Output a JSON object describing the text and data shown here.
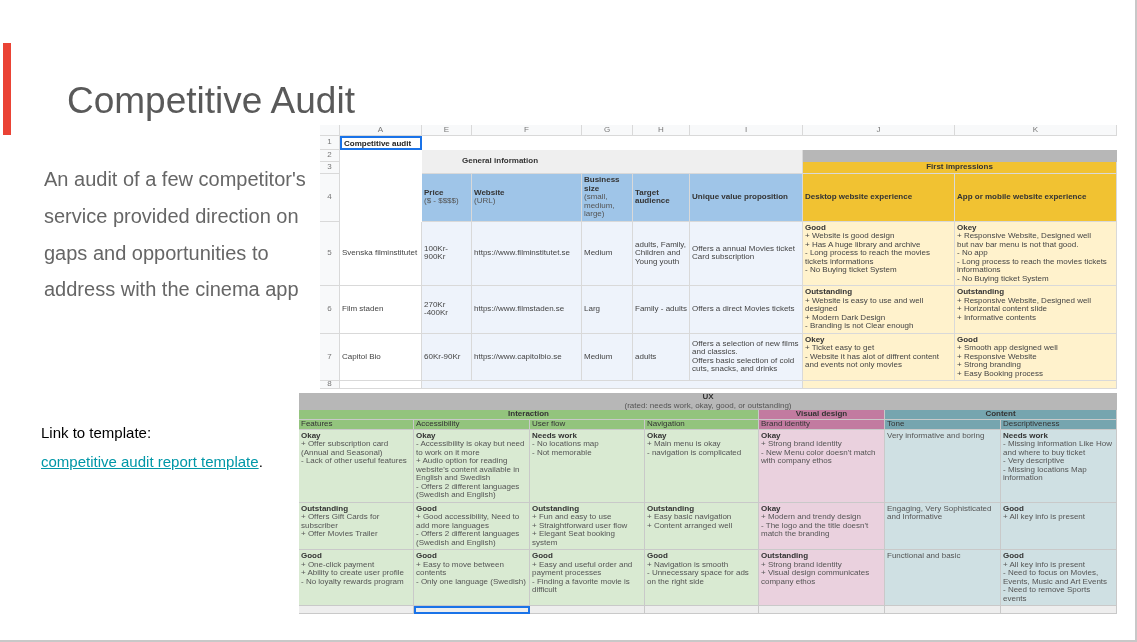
{
  "slide": {
    "title": "Competitive Audit",
    "body": "An audit of a few competitor's service provided direction on gaps and opportunities to address with the cinema app",
    "link_prefix": "Link to template:",
    "link_text": "competitive audit report template",
    "link_suffix": "."
  },
  "top_sheet": {
    "column_headers": [
      "A",
      "E",
      "F",
      "G",
      "H",
      "I",
      "J",
      "K"
    ],
    "row_numbers": [
      "1",
      "2",
      "3",
      "4",
      "5",
      "6",
      "7",
      "8"
    ],
    "title_cell": {
      "text": "Competitive audit",
      "selected": true
    },
    "general_header": "General information",
    "impressions_header": "First impressions",
    "columns": [
      {
        "label": "Price",
        "sublabel": "($ - $$$$)"
      },
      {
        "label": "Website",
        "sublabel": "(URL)"
      },
      {
        "label": "Business size",
        "sublabel": "(small, medium, large)"
      },
      {
        "label": "Target audience"
      },
      {
        "label": "Unique value proposition"
      },
      {
        "label": "Desktop website experience"
      },
      {
        "label": "App or mobile website experience"
      }
    ],
    "rows": [
      {
        "competitor": "Svenska filminstitutet",
        "price": "100Kr- 900Kr",
        "website": "https://www.filminstitutet.se",
        "business_size": "Medium",
        "target_audience": "adults, Family, Children and Young youth",
        "value_proposition": [
          "Offers a annual Movies ticket Card subscription"
        ],
        "desktop": {
          "rating": "Good",
          "lines": [
            "+ Website is good design",
            "+ Has A huge library and archive",
            "- Long process to reach the movies tickets informations",
            "- No Buying ticket System"
          ]
        },
        "mobile": {
          "rating": "Okey",
          "lines": [
            "+ Responsive Website, Designed well",
            "but nav bar menu is not that good.",
            "- No app",
            "- Long process to reach the movies tickets informations",
            "- No Buying ticket System"
          ]
        }
      },
      {
        "competitor": "Film staden",
        "price": "270Kr -400Kr",
        "website": "https://www.filmstaden.se",
        "business_size": "Larg",
        "target_audience": "Family - adults",
        "value_proposition": [
          "Offers a direct Movies tickets"
        ],
        "desktop": {
          "rating": "Outstanding",
          "lines": [
            "+ Website is easy to use and well designed",
            "+ Modern Dark Design",
            "- Branding is not Clear enough"
          ]
        },
        "mobile": {
          "rating": "Outstanding",
          "lines": [
            "+ Responsive Website, Designed well",
            "+ Horizontal content slide",
            "+ Informative contents"
          ]
        }
      },
      {
        "competitor": "Capitol Bio",
        "price": "60Kr-90Kr",
        "website": "https://www.capitolbio.se",
        "business_size": "Medium",
        "target_audience": "adults",
        "value_proposition": [
          "Offers a  selection of new films and classics.",
          "Offers basic selection of cold cuts, snacks, and drinks"
        ],
        "desktop": {
          "rating": "Okey",
          "lines": [
            "+ Ticket easy to get",
            "- Website it has alot of diffrent content",
            "and events not only movies"
          ]
        },
        "mobile": {
          "rating": "Good",
          "lines": [
            "+ Smooth app designed well",
            "+ Responsive Website",
            "+ Strong branding",
            "+ Easy Booking process"
          ]
        }
      }
    ]
  },
  "bottom_sheet": {
    "title": "UX",
    "subtitle": "(rated: needs work, okay, good, or outstanding)",
    "groups": [
      {
        "label": "Interaction",
        "color": "#93c47d",
        "columns": [
          {
            "label": "Features",
            "cells": [
              {
                "rating": "Okay",
                "lines": [
                  "+ Offer subscription card (Annual and Seasonal)",
                  "- Lack of other useful features"
                ]
              },
              {
                "rating": "Outstanding",
                "lines": [
                  "+ Offers Gift Cards for subscriber",
                  "+ Offer Movies Trailer"
                ]
              },
              {
                "rating": "Good",
                "lines": [
                  "+ One-click payment",
                  "+ Ability to create user profile",
                  "- No loyalty rewards program"
                ]
              }
            ]
          },
          {
            "label": "Accessibility",
            "cells": [
              {
                "rating": "Okay",
                "lines": [
                  "- Accessibility is okay but need to work on it more",
                  "+ Audio option for reading website's content available in English and Swedish",
                  "- Offers 2 different languages (Swedish and English)"
                ]
              },
              {
                "rating": "Good",
                "lines": [
                  "+ Good accessibility, Need to add more languages",
                  "- Offers 2 different languages (Swedish and English)"
                ]
              },
              {
                "rating": "Good",
                "lines": [
                  "+ Easy to move between contents",
                  "- Only one language (Swedish)"
                ]
              }
            ]
          },
          {
            "label": "User flow",
            "cells": [
              {
                "rating": "Needs work",
                "lines": [
                  "- No locations map",
                  "- Not memorable"
                ]
              },
              {
                "rating": "Outstanding",
                "lines": [
                  "+ Fun and easy to use",
                  "+ Straightforward user flow",
                  "+ Elegant Seat booking system"
                ]
              },
              {
                "rating": "Good",
                "lines": [
                  "+ Easy and useful order and payment processes",
                  "- Finding a favorite movie is difficult"
                ]
              }
            ]
          },
          {
            "label": "Navigation",
            "cells": [
              {
                "rating": "Okay",
                "lines": [
                  "+ Main menu is okay",
                  "- navigation is complicated"
                ]
              },
              {
                "rating": "Outstanding",
                "lines": [
                  "+ Easy basic navigation",
                  "+ Content arranged well"
                ]
              },
              {
                "rating": "Good",
                "lines": [
                  "+ Navigation is smooth",
                  "- Unnecessary space for ads on the right side"
                ]
              }
            ]
          }
        ]
      },
      {
        "label": "Visual design",
        "color": "#c27ba0",
        "columns": [
          {
            "label": "Brand identity",
            "cells": [
              {
                "rating": "Okay",
                "lines": [
                  "+ Strong brand identity",
                  "- New Menu color doesn't match with company ethos"
                ]
              },
              {
                "rating": "Okay",
                "lines": [
                  "+ Modern and trendy design",
                  "- The logo and the title doesn't match the branding"
                ]
              },
              {
                "rating": "Outstanding",
                "lines": [
                  "+ Strong brand identity",
                  "+ Visual design communicates company ethos"
                ]
              }
            ]
          }
        ]
      },
      {
        "label": "Content",
        "color": "#76a5af",
        "columns": [
          {
            "label": "Tone",
            "cells": [
              {
                "lines": [
                  "Very informative and boring"
                ]
              },
              {
                "lines": [
                  "Engaging, Very Sophisticated and Informative"
                ]
              },
              {
                "lines": [
                  "Functional and basic"
                ]
              }
            ]
          },
          {
            "label": "Descriptiveness",
            "cells": [
              {
                "rating": "Needs work",
                "lines": [
                  "- Missing information Like How and where to buy ticket",
                  "- Very descriptive",
                  "- Missing locations Map information"
                ]
              },
              {
                "rating": "Good",
                "lines": [
                  "+ All key info is present"
                ]
              },
              {
                "rating": "Good",
                "lines": [
                  "+ All key info is present",
                  "- Need to focus on Movies, Events, Music and Art Events",
                  "- Need to remove Sports events"
                ]
              }
            ]
          }
        ]
      }
    ],
    "blank_row": [
      {
        "selected": false
      },
      {
        "selected": true
      },
      {
        "selected": false
      },
      {
        "selected": false
      },
      {
        "selected": false
      },
      {
        "selected": false
      },
      {
        "selected": false
      }
    ]
  }
}
